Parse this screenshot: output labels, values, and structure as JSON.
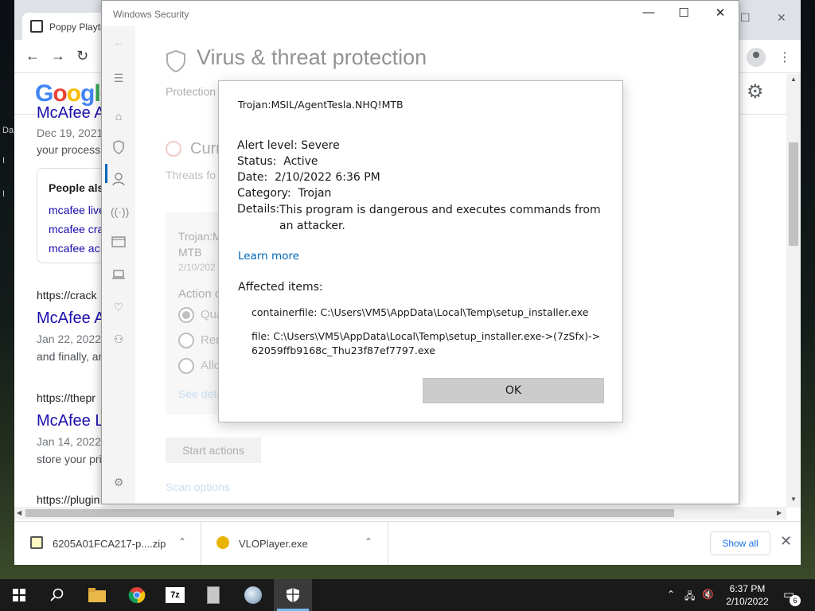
{
  "desktop": {
    "letters": [
      "Da",
      "I",
      "I"
    ]
  },
  "chrome": {
    "tab_title": "Poppy Playti",
    "window_controls": {
      "minimize": "—",
      "maximize": "☐",
      "close": "✕"
    },
    "nav": {
      "back": "←",
      "forward": "→",
      "reload": "↻"
    },
    "google_logo": [
      "G",
      "o",
      "o",
      "g",
      "l",
      "e"
    ],
    "results": [
      {
        "title_partial": "McAfee A",
        "date": "Dec 19, 2021",
        "snippet": "your process"
      },
      {
        "url": "https://crack",
        "title": "McAfee A",
        "date": "Jan 22, 2022",
        "snippet": "and finally, an"
      },
      {
        "url": "https://thepr",
        "title": "McAfee L",
        "date": "Jan 14, 2022",
        "snippet": "store your pri"
      },
      {
        "url": "https://plugin"
      }
    ],
    "people_also_search": {
      "title": "People als",
      "links": [
        "mcafee live",
        "mcafee cra",
        "mcafee ac"
      ]
    },
    "downloads": [
      {
        "label": "6205A01FCA217-p....zip",
        "icon": "zip-file-icon"
      },
      {
        "label": "VLOPlayer.exe",
        "icon": "exe-file-icon"
      }
    ],
    "show_all": "Show all",
    "close_downloads": "✕"
  },
  "windows_security": {
    "title": "Windows Security",
    "controls": {
      "minimize": "—",
      "maximize": "☐",
      "close": "✕"
    },
    "heading": "Virus & threat protection",
    "subheading": "Protection",
    "section": "Curr",
    "threats_text": "Threats fo",
    "card": {
      "name": "Trojan:M MTB",
      "date": "2/10/202",
      "action_label": "Action o",
      "options": [
        {
          "label": "Qua",
          "selected": true
        },
        {
          "label": "Rem",
          "selected": false
        },
        {
          "label": "Allo",
          "selected": false
        }
      ],
      "details_link": "See deta"
    },
    "start_actions": "Start actions",
    "scan_options": "Scan options"
  },
  "alert": {
    "threat_name": "Trojan:MSIL/AgentTesla.NHQ!MTB",
    "alert_level_label": "Alert level:",
    "alert_level": "Severe",
    "status_label": "Status:",
    "status": "Active",
    "date_label": "Date:",
    "date": "2/10/2022 6:36 PM",
    "category_label": "Category:",
    "category": "Trojan",
    "details_label": "Details:",
    "details": "This program is dangerous and executes commands from an attacker.",
    "learn_more": "Learn more",
    "affected_label": "Affected items:",
    "affected_items": [
      "containerfile: C:\\Users\\VM5\\AppData\\Local\\Temp\\setup_installer.exe",
      "file: C:\\Users\\VM5\\AppData\\Local\\Temp\\setup_installer.exe->(7zSfx)->62059ffb9168c_Thu23f87ef7797.exe"
    ],
    "ok_button": "OK"
  },
  "taskbar": {
    "apps": [
      "windows-start-icon",
      "search-icon",
      "file-explorer-icon",
      "chrome-icon",
      "7zip-icon",
      "installer-icon",
      "network-globe-icon",
      "windows-security-icon"
    ],
    "clock_time": "6:37 PM",
    "clock_date": "2/10/2022",
    "notification_count": "6"
  }
}
